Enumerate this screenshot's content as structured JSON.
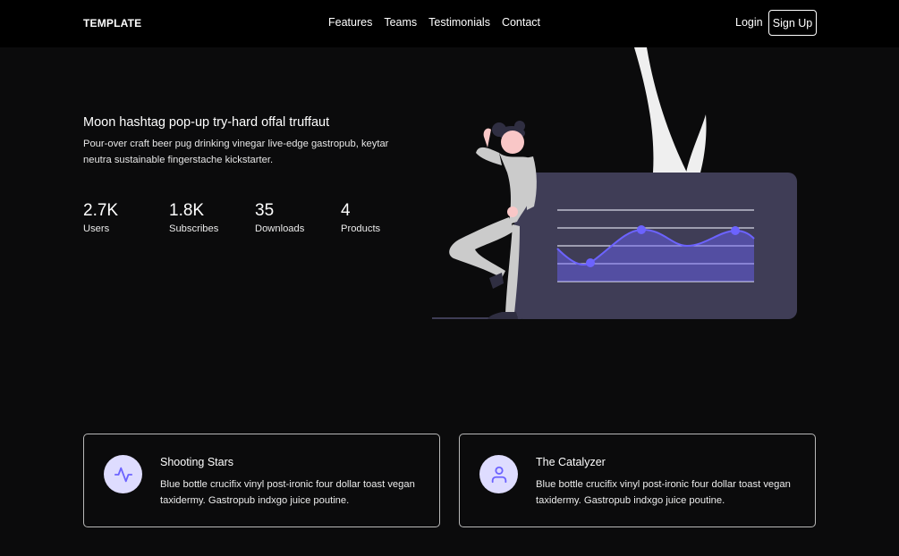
{
  "nav": {
    "brand": "TEMPLATE",
    "links": [
      "Features",
      "Teams",
      "Testimonials",
      "Contact"
    ],
    "login": "Login",
    "signup": "Sign Up"
  },
  "hero": {
    "title": "Moon hashtag pop-up try-hard offal truffaut",
    "description": "Pour-over craft beer pug drinking vinegar live-edge gastropub, keytar neutra sustainable fingerstache kickstarter.",
    "stats": [
      {
        "value": "2.7K",
        "label": "Users"
      },
      {
        "value": "1.8K",
        "label": "Subscribes"
      },
      {
        "value": "35",
        "label": "Downloads"
      },
      {
        "value": "4",
        "label": "Products"
      }
    ]
  },
  "features": [
    {
      "icon": "activity-icon",
      "title": "Shooting Stars",
      "text": "Blue bottle crucifix vinyl post-ironic four dollar toast vegan taxidermy. Gastropub indxgo juice poutine."
    },
    {
      "icon": "user-icon",
      "title": "The Catalyzer",
      "text": "Blue bottle crucifix vinyl post-ironic four dollar toast vegan taxidermy. Gastropub indxgo juice poutine."
    }
  ],
  "colors": {
    "accent": "#6c63ff",
    "icon_bg": "#dedcff",
    "board": "#3f3d56",
    "figure": "#cbcbcb"
  }
}
